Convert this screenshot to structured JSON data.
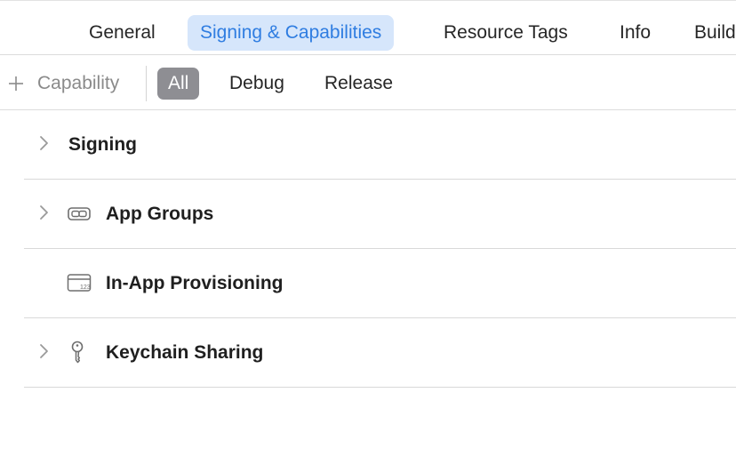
{
  "tabs": [
    {
      "label": "General",
      "active": false
    },
    {
      "label": "Signing & Capabilities",
      "active": true
    },
    {
      "label": "Resource Tags",
      "active": false
    },
    {
      "label": "Info",
      "active": false
    },
    {
      "label": "Build",
      "active": false
    }
  ],
  "toolbar": {
    "add_capability_label": "Capability",
    "add_capability_icon": "plus-icon",
    "configurations": [
      {
        "label": "All",
        "selected": true
      },
      {
        "label": "Debug",
        "selected": false
      },
      {
        "label": "Release",
        "selected": false
      }
    ]
  },
  "capabilities": [
    {
      "title": "Signing",
      "icon": null,
      "expandable": true
    },
    {
      "title": "App Groups",
      "icon": "app-groups-icon",
      "expandable": true
    },
    {
      "title": "In-App Provisioning",
      "icon": "card-icon",
      "expandable": false
    },
    {
      "title": "Keychain Sharing",
      "icon": "key-icon",
      "expandable": true
    }
  ],
  "colors": {
    "accent": "#2f7de1",
    "active_tab_bg": "#d6e6fb",
    "segment_selected_bg": "#8e8e93"
  }
}
